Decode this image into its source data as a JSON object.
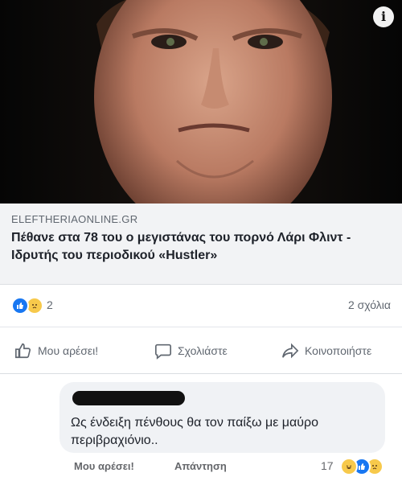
{
  "post": {
    "domain": "ELEFTHERIAONLINE.GR",
    "headline": "Πέθανε στα 78 του ο μεγιστάνας του πορνό Λάρι Φλιντ - Ιδρυτής του περιοδικού «Hustler»",
    "info_icon": "i"
  },
  "stats": {
    "reaction_count": "2",
    "comments": "2 σχόλια",
    "icons": [
      "like-reaction-icon",
      "sad-reaction-icon"
    ]
  },
  "actions": {
    "like": "Μου αρέσει!",
    "comment": "Σχολιάστε",
    "share": "Κοινοποιήστε"
  },
  "comment": {
    "text": "Ως ένδειξη πένθους θα τον παίξω με μαύρο περιβραχιόνιο..",
    "like_label": "Μου αρέσει!",
    "reply_label": "Απάντηση",
    "reaction_count": "17"
  },
  "colors": {
    "like_blue": "#1877f2",
    "haha_yellow": "#f7c94b",
    "text_gray": "#606770"
  }
}
